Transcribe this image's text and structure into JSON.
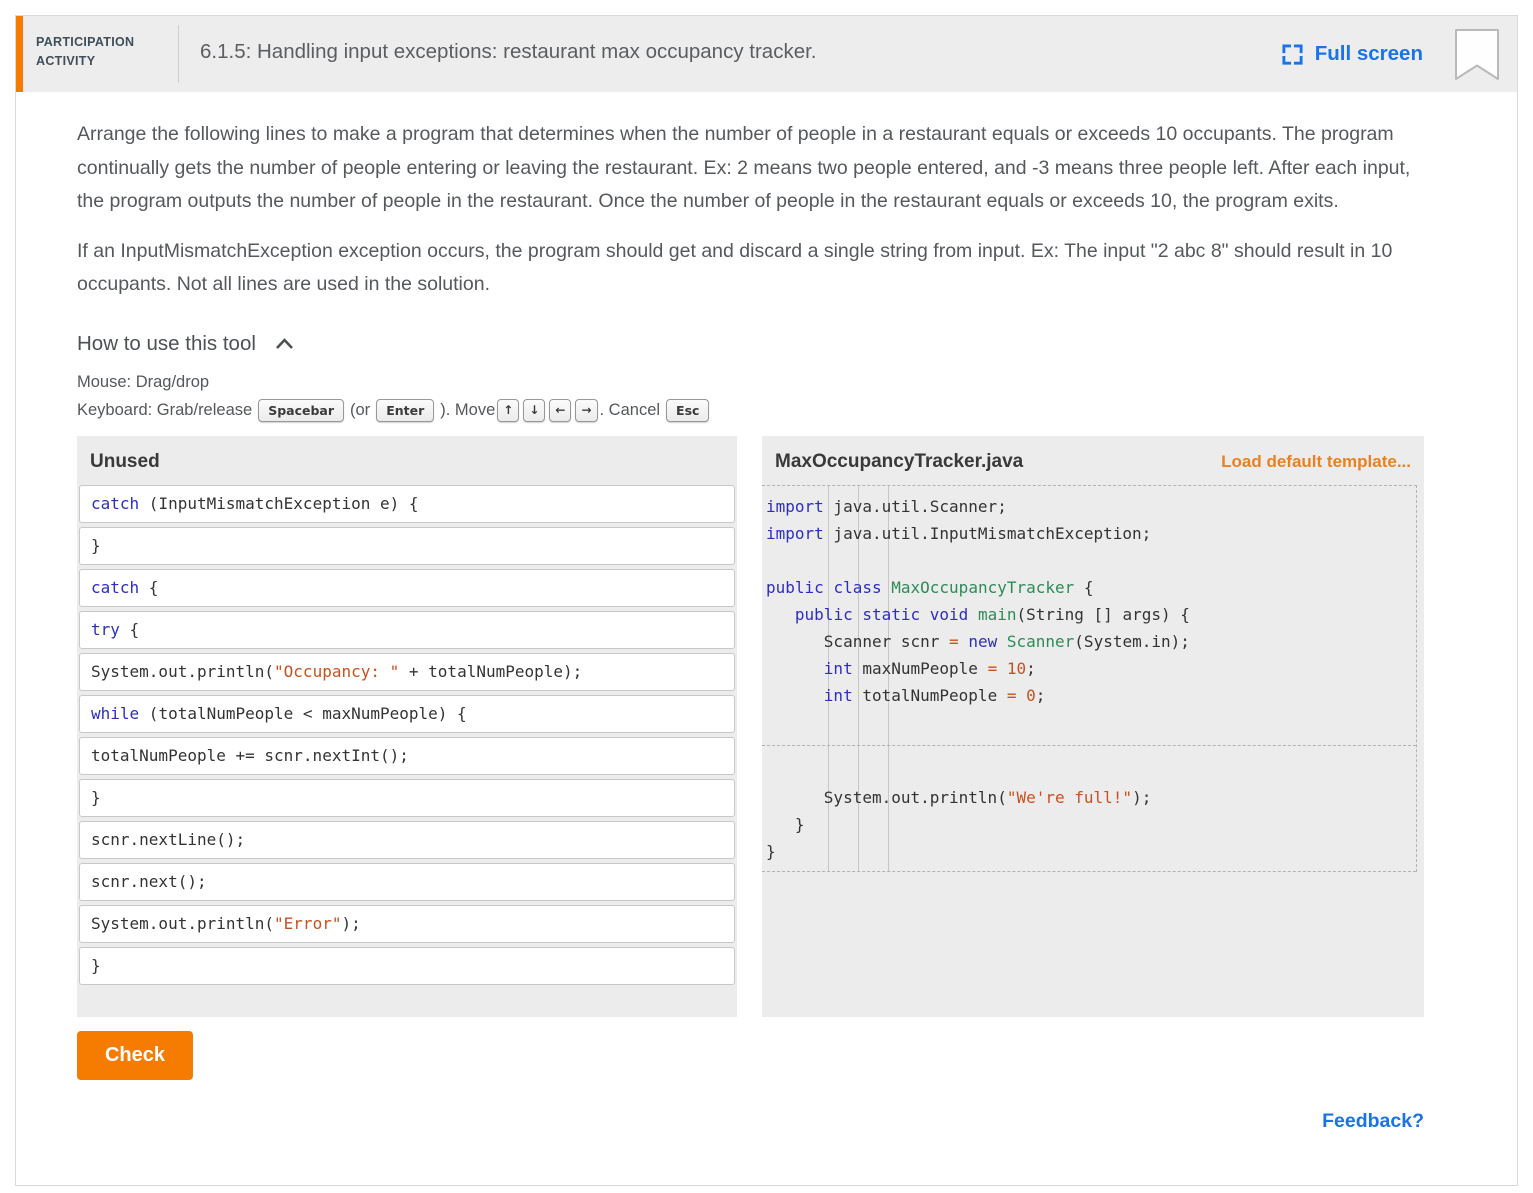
{
  "colors": {
    "accent_orange": "#f57c00",
    "link_orange": "#e8821e",
    "link_blue": "#1a73e8",
    "keyword": "#2d2dc0",
    "type_name": "#2e8b57",
    "string_literal": "#c7511f",
    "number_literal": "#c7511f"
  },
  "header": {
    "activity_type": "PARTICIPATION ACTIVITY",
    "title": "6.1.5: Handling input exceptions: restaurant max occupancy tracker.",
    "fullscreen_label": "Full screen"
  },
  "intro": {
    "paragraph1": "Arrange the following lines to make a program that determines when the number of people in a restaurant equals or exceeds 10 occupants. The program continually gets the number of people entering or leaving the restaurant. Ex: 2 means two people entered, and -3 means three people left. After each input, the program outputs the number of people in the restaurant. Once the number of people in the restaurant equals or exceeds 10, the program exits.",
    "paragraph2": "If an InputMismatchException exception occurs, the program should get and discard a single string from input. Ex: The input \"2 abc 8\" should result in 10 occupants. Not all lines are used in the solution."
  },
  "tool_help": {
    "toggle_label": "How to use this tool",
    "mouse_line": "Mouse: Drag/drop",
    "keyboard": {
      "prefix": "Keyboard: Grab/release",
      "spacebar_key": "Spacebar",
      "or_text": "(or",
      "enter_key": "Enter",
      "move_text": "). Move",
      "arrow_keys": [
        "↑",
        "↓",
        "←",
        "→"
      ],
      "cancel_text": ". Cancel",
      "esc_key": "Esc"
    }
  },
  "unused_panel": {
    "title": "Unused",
    "lines": [
      [
        [
          "kw",
          "catch"
        ],
        [
          "plain",
          " (InputMismatchException e) {"
        ]
      ],
      [
        [
          "plain",
          "}"
        ]
      ],
      [
        [
          "kw",
          "catch"
        ],
        [
          "plain",
          " {"
        ]
      ],
      [
        [
          "kw",
          "try"
        ],
        [
          "plain",
          " {"
        ]
      ],
      [
        [
          "plain",
          "System.out.println("
        ],
        [
          "str",
          "\"Occupancy: \""
        ],
        [
          "plain",
          " + totalNumPeople);"
        ]
      ],
      [
        [
          "kw",
          "while"
        ],
        [
          "plain",
          " (totalNumPeople < maxNumPeople) {"
        ]
      ],
      [
        [
          "plain",
          "totalNumPeople += scnr.nextInt();"
        ]
      ],
      [
        [
          "plain",
          "}"
        ]
      ],
      [
        [
          "plain",
          "scnr.nextLine();"
        ]
      ],
      [
        [
          "plain",
          "scnr.next();"
        ]
      ],
      [
        [
          "plain",
          "System.out.println("
        ],
        [
          "str",
          "\"Error\""
        ],
        [
          "plain",
          ");"
        ]
      ],
      [
        [
          "plain",
          "}"
        ]
      ]
    ]
  },
  "target_panel": {
    "title": "MaxOccupancyTracker.java",
    "load_template_label": "Load default template...",
    "code_block_1": [
      [
        [
          "kw",
          "import"
        ],
        [
          "plain",
          " java.util.Scanner;"
        ]
      ],
      [
        [
          "kw",
          "import"
        ],
        [
          "plain",
          " java.util.InputMismatchException;"
        ]
      ],
      [],
      [
        [
          "kw",
          "public"
        ],
        [
          "plain",
          " "
        ],
        [
          "kw",
          "class"
        ],
        [
          "plain",
          " "
        ],
        [
          "type",
          "MaxOccupancyTracker"
        ],
        [
          "plain",
          " {"
        ]
      ],
      [
        [
          "plain",
          "   "
        ],
        [
          "kw",
          "public"
        ],
        [
          "plain",
          " "
        ],
        [
          "kw",
          "static"
        ],
        [
          "plain",
          " "
        ],
        [
          "kw",
          "void"
        ],
        [
          "plain",
          " "
        ],
        [
          "type",
          "main"
        ],
        [
          "plain",
          "(String [] args) {"
        ]
      ],
      [
        [
          "plain",
          "      Scanner scnr "
        ],
        [
          "op",
          "="
        ],
        [
          "plain",
          " "
        ],
        [
          "kw",
          "new"
        ],
        [
          "plain",
          " "
        ],
        [
          "type",
          "Scanner"
        ],
        [
          "plain",
          "(System.in);"
        ]
      ],
      [
        [
          "plain",
          "      "
        ],
        [
          "kw",
          "int"
        ],
        [
          "plain",
          " maxNumPeople "
        ],
        [
          "op",
          "="
        ],
        [
          "plain",
          " "
        ],
        [
          "num",
          "10"
        ],
        [
          "plain",
          ";"
        ]
      ],
      [
        [
          "plain",
          "      "
        ],
        [
          "kw",
          "int"
        ],
        [
          "plain",
          " totalNumPeople "
        ],
        [
          "op",
          "="
        ],
        [
          "plain",
          " "
        ],
        [
          "num",
          "0"
        ],
        [
          "plain",
          ";"
        ]
      ]
    ],
    "code_block_2": [
      [
        [
          "plain",
          "      System.out.println("
        ],
        [
          "str",
          "\"We're full!\""
        ],
        [
          "plain",
          ");"
        ]
      ],
      [
        [
          "plain",
          "   }"
        ]
      ],
      [
        [
          "plain",
          "}"
        ]
      ]
    ]
  },
  "check_button_label": "Check",
  "feedback_label": "Feedback?"
}
